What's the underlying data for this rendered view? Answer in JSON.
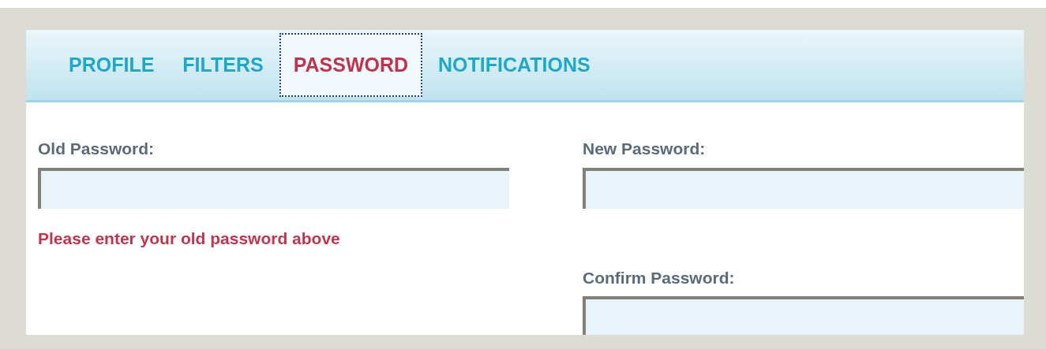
{
  "tabs": [
    {
      "label": "PROFILE",
      "selected": false
    },
    {
      "label": "FILTERS",
      "selected": false
    },
    {
      "label": "PASSWORD",
      "selected": true
    },
    {
      "label": "NOTIFICATIONS",
      "selected": false
    }
  ],
  "old_password": {
    "label": "Old Password:",
    "error": "Please enter your old password above"
  },
  "new_password": {
    "label": "New Password:"
  },
  "confirm_password": {
    "label": "Confirm Password:"
  }
}
